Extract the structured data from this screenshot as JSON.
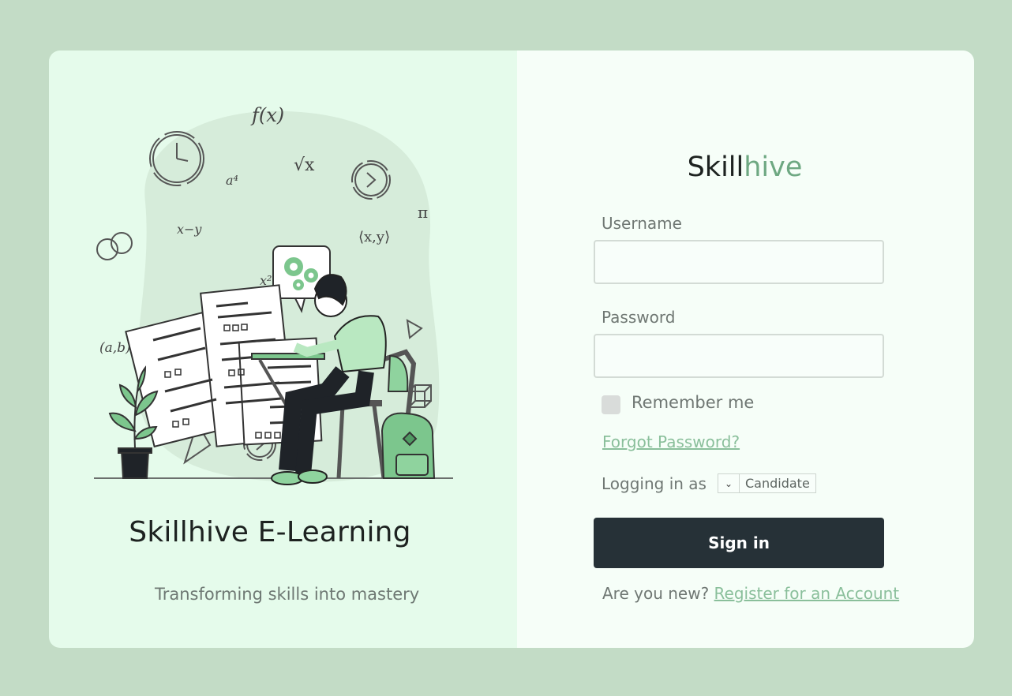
{
  "hero": {
    "title": "Skillhive E-Learning",
    "subtitle": "Transforming skills into mastery"
  },
  "illustration": {
    "math_symbols": [
      "f(x)",
      "a⁴",
      "√x",
      "x−y",
      "π",
      "⟨x,y⟩",
      "x²",
      "(a,b)"
    ]
  },
  "login": {
    "brand_dark": "Skill",
    "brand_accent": "hive",
    "username_label": "Username",
    "username_value": "",
    "password_label": "Password",
    "password_value": "",
    "remember_label": "Remember me",
    "remember_checked": false,
    "forgot_link": "Forgot Password?",
    "logging_as_label": "Logging in as",
    "role_selected": "Candidate",
    "signin_label": "Sign in",
    "new_prompt": "Are you new?",
    "register_link": "Register for an Account"
  },
  "colors": {
    "page_bg": "#c3dcc6",
    "left_panel": "#e5fbeb",
    "right_panel": "#f6fef8",
    "accent": "#6ea882",
    "link": "#8abf9b",
    "button": "#263137"
  }
}
